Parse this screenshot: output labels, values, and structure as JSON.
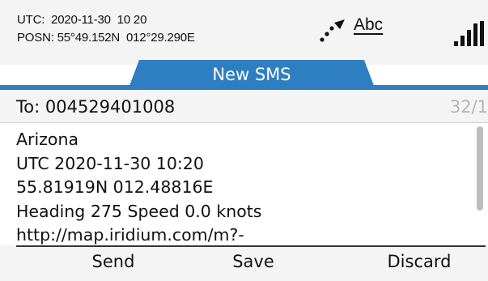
{
  "status": {
    "utc_line": "UTC:  2020-11-30  10 20",
    "posn_line": "POSN: 55°49.152N  012°29.290E",
    "input_mode": "Abc",
    "gps_icon": "gps-fix-icon",
    "signal_icon": "signal-strength-icon"
  },
  "screen": {
    "title": "New SMS",
    "accent_color": "#2e7fc1"
  },
  "recipient": {
    "label": "To: 004529401008",
    "counter": "32/1"
  },
  "message": {
    "text": "Arizona\nUTC 2020-11-30 10:20\n55.81919N 012.48816E\nHeading 275 Speed 0.0 knots\nhttp://map.iridium.com/m?-"
  },
  "softkeys": {
    "send": "Send",
    "save": "Save",
    "discard": "Discard"
  }
}
